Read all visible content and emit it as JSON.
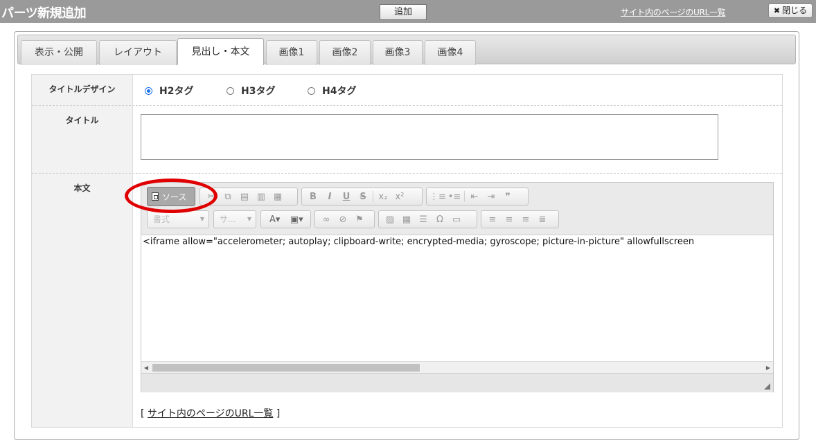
{
  "header": {
    "title": "パーツ新規追加",
    "add_label": "追加",
    "url_list_label": "サイト内のページのURL一覧",
    "close_label": "閉じる"
  },
  "tabs": [
    {
      "label": "表示・公開"
    },
    {
      "label": "レイアウト"
    },
    {
      "label": "見出し・本文",
      "active": true
    },
    {
      "label": "画像1"
    },
    {
      "label": "画像2"
    },
    {
      "label": "画像3"
    },
    {
      "label": "画像4"
    }
  ],
  "form": {
    "title_design": {
      "label": "タイトルデザイン",
      "options": [
        "H2タグ",
        "H3タグ",
        "H4タグ"
      ],
      "selected": "H2タグ"
    },
    "title": {
      "label": "タイトル",
      "value": ""
    },
    "body": {
      "label": "本文",
      "source_label": "ソース",
      "format_placeholder": "書式",
      "size_placeholder": "サ...",
      "content": "<iframe allow=\"accelerometer; autoplay; clipboard-write; encrypted-media; gyroscope; picture-in-picture\" allowfullscreen"
    },
    "url_list": {
      "prefix": "[",
      "link": "サイト内のページのURL一覧",
      "suffix": "]"
    }
  },
  "colors": {
    "header_bg": "#9a9a9a",
    "annotation": "#e00000",
    "radio_accent": "#1a73e8"
  }
}
